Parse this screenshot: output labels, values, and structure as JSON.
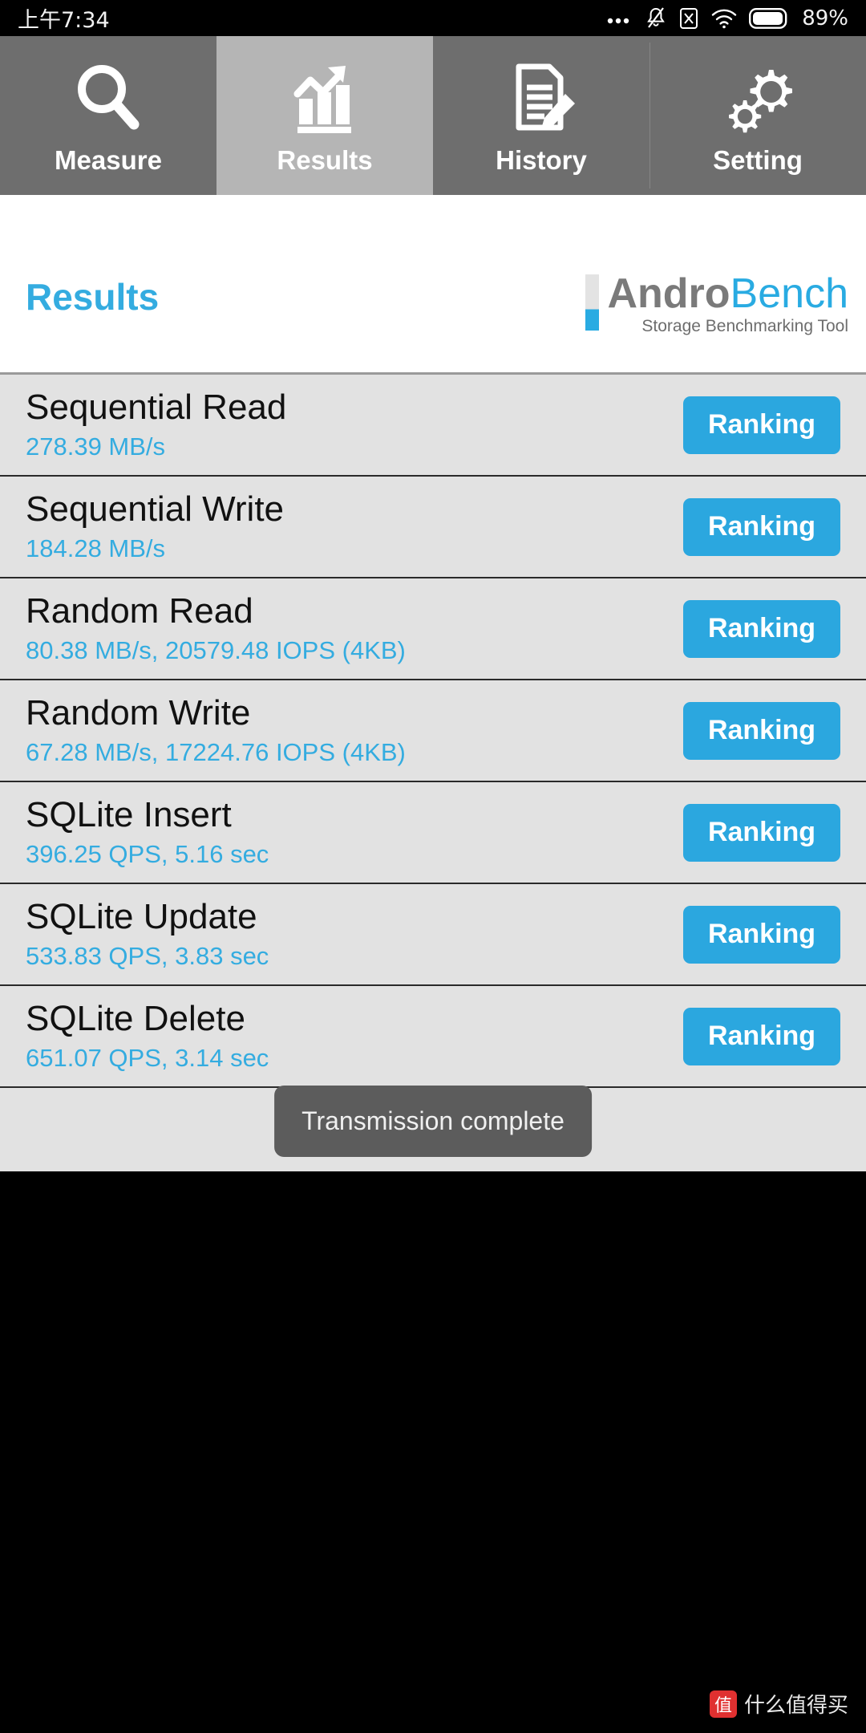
{
  "status_bar": {
    "time": "上午7:34",
    "battery_percent": "89%",
    "icons": [
      "more-dots-icon",
      "bell-muted-icon",
      "sim-x-icon",
      "wifi-icon",
      "battery-icon"
    ]
  },
  "tabs": [
    {
      "label": "Measure",
      "icon": "magnifier-icon",
      "selected": false
    },
    {
      "label": "Results",
      "icon": "bar-chart-arrow-icon",
      "selected": true
    },
    {
      "label": "History",
      "icon": "document-pencil-icon",
      "selected": false
    },
    {
      "label": "Setting",
      "icon": "gears-icon",
      "selected": false
    }
  ],
  "header": {
    "title": "Results",
    "logo_primary": "Andro",
    "logo_secondary": "Bench",
    "logo_tagline": "Storage Benchmarking Tool"
  },
  "results": [
    {
      "name": "Sequential Read",
      "value": "278.39 MB/s",
      "action": "Ranking"
    },
    {
      "name": "Sequential Write",
      "value": "184.28 MB/s",
      "action": "Ranking"
    },
    {
      "name": "Random Read",
      "value": "80.38 MB/s, 20579.48 IOPS (4KB)",
      "action": "Ranking"
    },
    {
      "name": "Random Write",
      "value": "67.28 MB/s, 17224.76 IOPS (4KB)",
      "action": "Ranking"
    },
    {
      "name": "SQLite Insert",
      "value": "396.25 QPS, 5.16 sec",
      "action": "Ranking"
    },
    {
      "name": "SQLite Update",
      "value": "533.83 QPS, 3.83 sec",
      "action": "Ranking"
    },
    {
      "name": "SQLite Delete",
      "value": "651.07 QPS, 3.14 sec",
      "action": "Ranking"
    }
  ],
  "toast": {
    "message": "Transmission complete"
  },
  "watermark": {
    "badge": "值",
    "text": "什么值得买"
  },
  "colors": {
    "accent_blue": "#34ACE0",
    "button_blue": "#2BA7DF",
    "tab_bg": "#6e6e6e",
    "tab_selected_bg": "#b5b5b5",
    "list_bg": "#e2e2e2"
  }
}
